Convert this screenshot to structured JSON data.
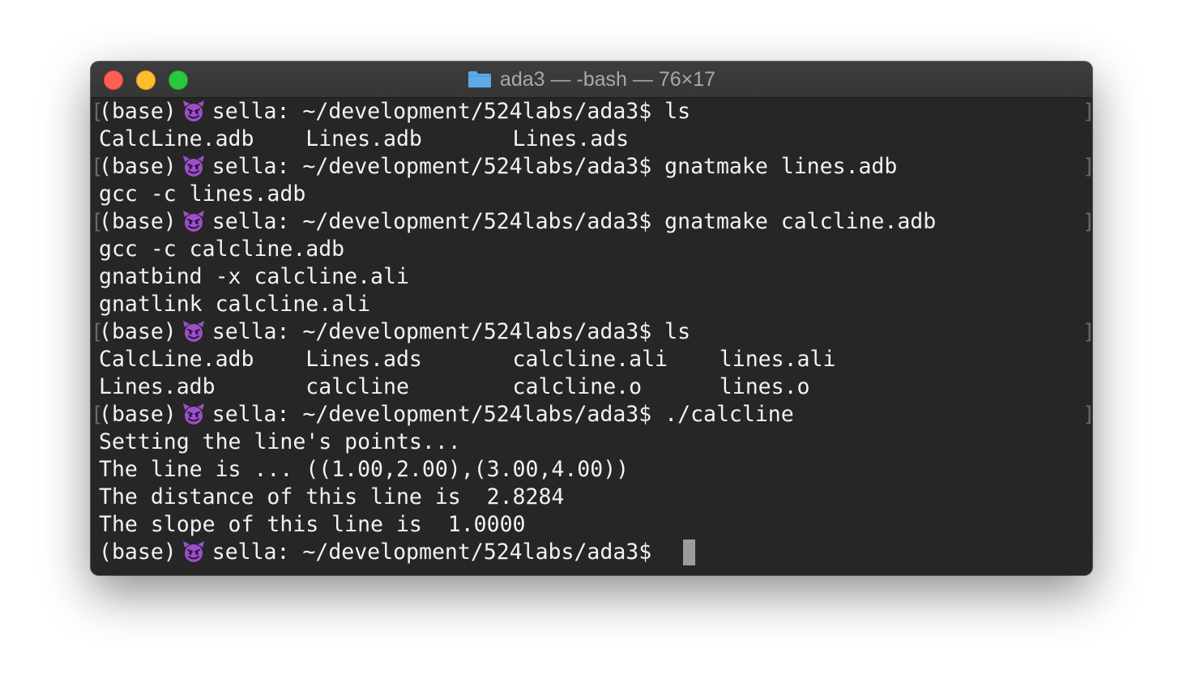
{
  "window": {
    "title": "ada3 — -bash — 76×17",
    "folder_icon": "folder-icon",
    "colors": {
      "background": "#262626",
      "text": "#f2f2f2",
      "close": "#fe5f57",
      "minimize": "#febc2e",
      "zoom": "#28c840",
      "folder": "#5eaae8",
      "emoji": "#9b4fc9"
    }
  },
  "prompt": {
    "env": "(base)",
    "emoji_icon": "smiling-devil-icon",
    "text": "sella: ~/development/524labs/ada3$"
  },
  "commands": [
    "ls",
    "gnatmake lines.adb",
    "gnatmake calcline.adb",
    "ls",
    "./calcline"
  ],
  "outputs": {
    "ls1": [
      "CalcLine.adb    Lines.adb       Lines.ads"
    ],
    "make1": [
      "gcc -c lines.adb"
    ],
    "make2": [
      "gcc -c calcline.adb",
      "gnatbind -x calcline.ali",
      "gnatlink calcline.ali"
    ],
    "ls2": [
      "CalcLine.adb    Lines.ads       calcline.ali    lines.ali",
      "Lines.adb       calcline        calcline.o      lines.o"
    ],
    "run": [
      "Setting the line's points...",
      "The line is ... ((1.00,2.00),(3.00,4.00))",
      "The distance of this line is  2.8284",
      "The slope of this line is  1.0000"
    ]
  },
  "brackets": {
    "left": "[",
    "right": "]"
  }
}
